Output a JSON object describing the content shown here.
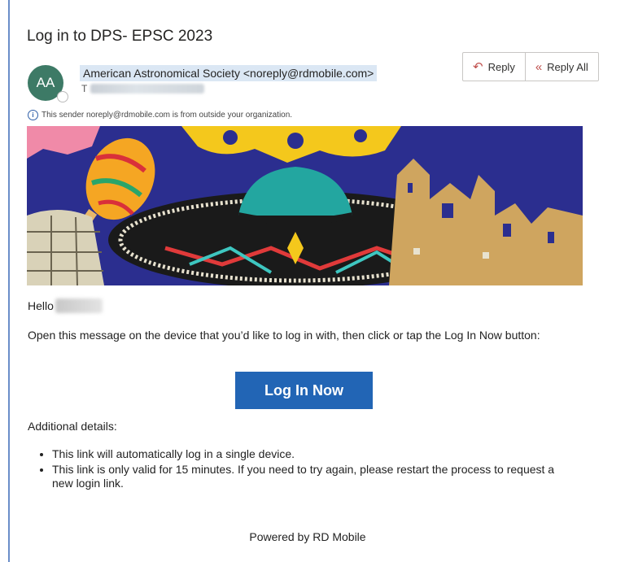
{
  "email": {
    "subject": "Log in to DPS- EPSC 2023",
    "avatar_initials": "AA",
    "sender": "American Astronomical Society <noreply@rdmobile.com>",
    "to_prefix": "T",
    "external_notice": "This sender noreply@rdmobile.com is from outside your organization.",
    "actions": {
      "reply_label": "Reply",
      "reply_all_label": "Reply All"
    }
  },
  "body": {
    "greeting": "Hello",
    "intro": "Open this message on the device that you’d like to log in with, then click or tap the Log In Now button:",
    "login_button": "Log In Now",
    "details_label": "Additional details:",
    "details": [
      "This link will automatically log in a single device.",
      "This link is only valid for 15 minutes. If you need to try again, please restart the process to request a new login link."
    ],
    "footer": "Powered by RD Mobile"
  },
  "colors": {
    "accent": "#2265b5",
    "avatar": "#3d7a66",
    "banner_bg": "#2b2e8f"
  }
}
